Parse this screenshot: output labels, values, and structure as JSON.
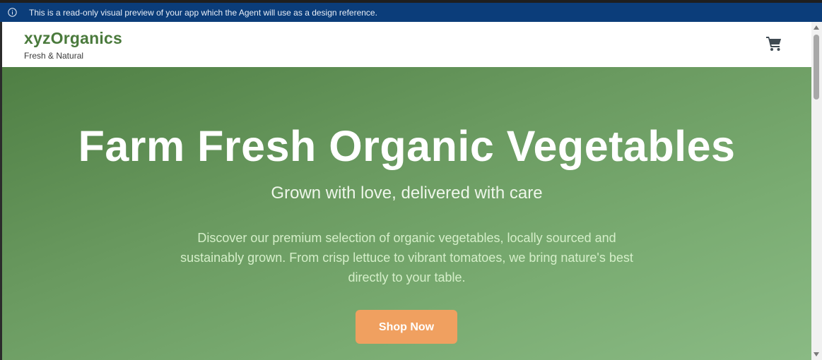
{
  "banner": {
    "text": "This is a read-only visual preview of your app which the Agent will use as a design reference.",
    "icon": "info-icon",
    "color": "#0b3d7a"
  },
  "header": {
    "brand_name": "xyzOrganics",
    "tagline": "Fresh & Natural",
    "cart_icon": "cart-icon",
    "brand_color": "#4a7a3c"
  },
  "hero": {
    "title": "Farm Fresh Organic Vegetables",
    "subtitle": "Grown with love, delivered with care",
    "description": "Discover our premium selection of organic vegetables, locally sourced and sustainably grown. From crisp lettuce to vibrant tomatoes, we bring nature's best directly to your table.",
    "cta_label": "Shop Now",
    "cta_color": "#f0a060"
  }
}
